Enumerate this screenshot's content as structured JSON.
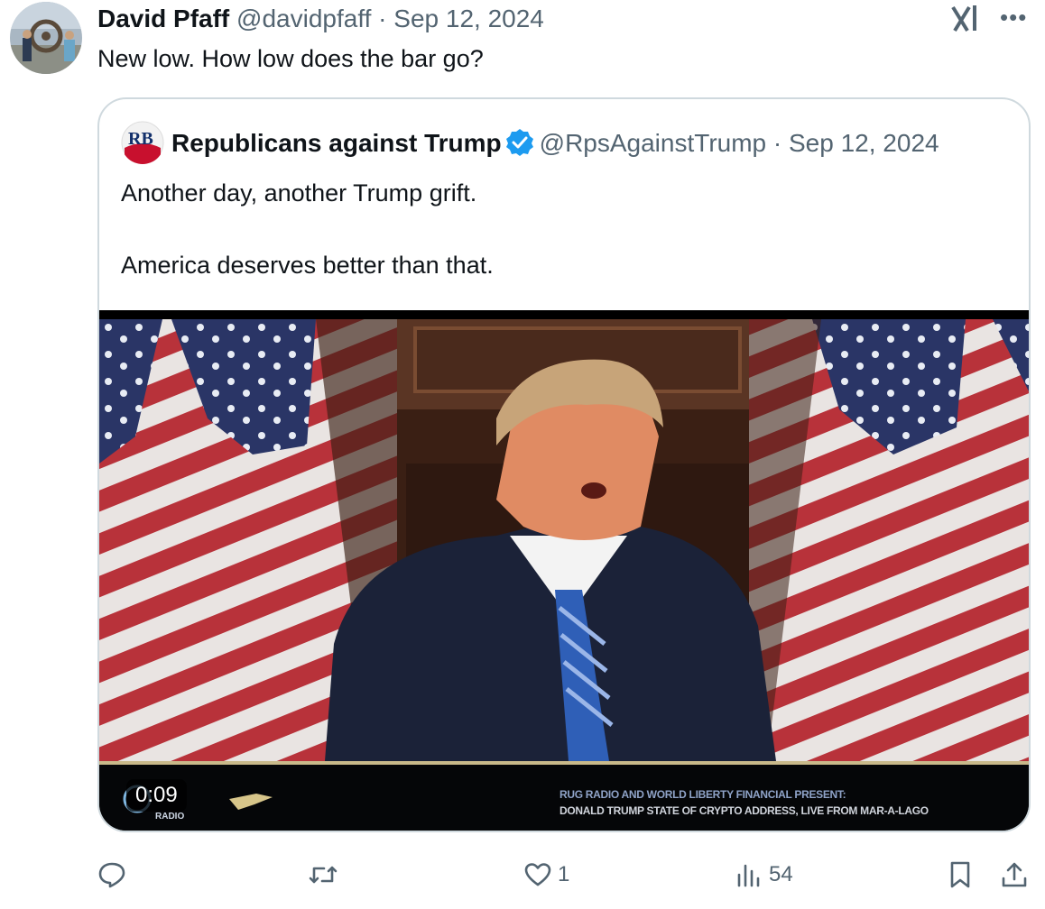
{
  "tweet": {
    "author_name": "David Pfaff",
    "handle": "@davidpfaff",
    "separator": "·",
    "date": "Sep 12, 2024",
    "text": "New low. How low does the bar go?"
  },
  "quoted": {
    "author_name": "Republicans against Trump",
    "avatar_text": "RB",
    "handle": "@RpsAgainstTrump",
    "separator": "·",
    "date": "Sep 12, 2024",
    "text_line1": "Another day, another Trump grift.",
    "text_line2": "America deserves better than that.",
    "video": {
      "timer": "0:09",
      "banner_line1": "RUG RADIO AND WORLD LIBERTY FINANCIAL PRESENT:",
      "banner_line2": "DONALD TRUMP STATE OF CRYPTO ADDRESS, LIVE FROM MAR-A-LAGO",
      "logo_text": "RADIO"
    }
  },
  "actions": {
    "reply_count": "",
    "retweet_count": "",
    "like_count": "1",
    "views_count": "54"
  },
  "icons": [
    "grok-icon",
    "more-icon",
    "verified-badge-icon",
    "reply-icon",
    "retweet-icon",
    "like-icon",
    "views-icon",
    "bookmark-icon",
    "share-icon"
  ],
  "colors": {
    "verified": "#1d9bf0",
    "muted": "#536471",
    "border": "#cfd9de"
  }
}
